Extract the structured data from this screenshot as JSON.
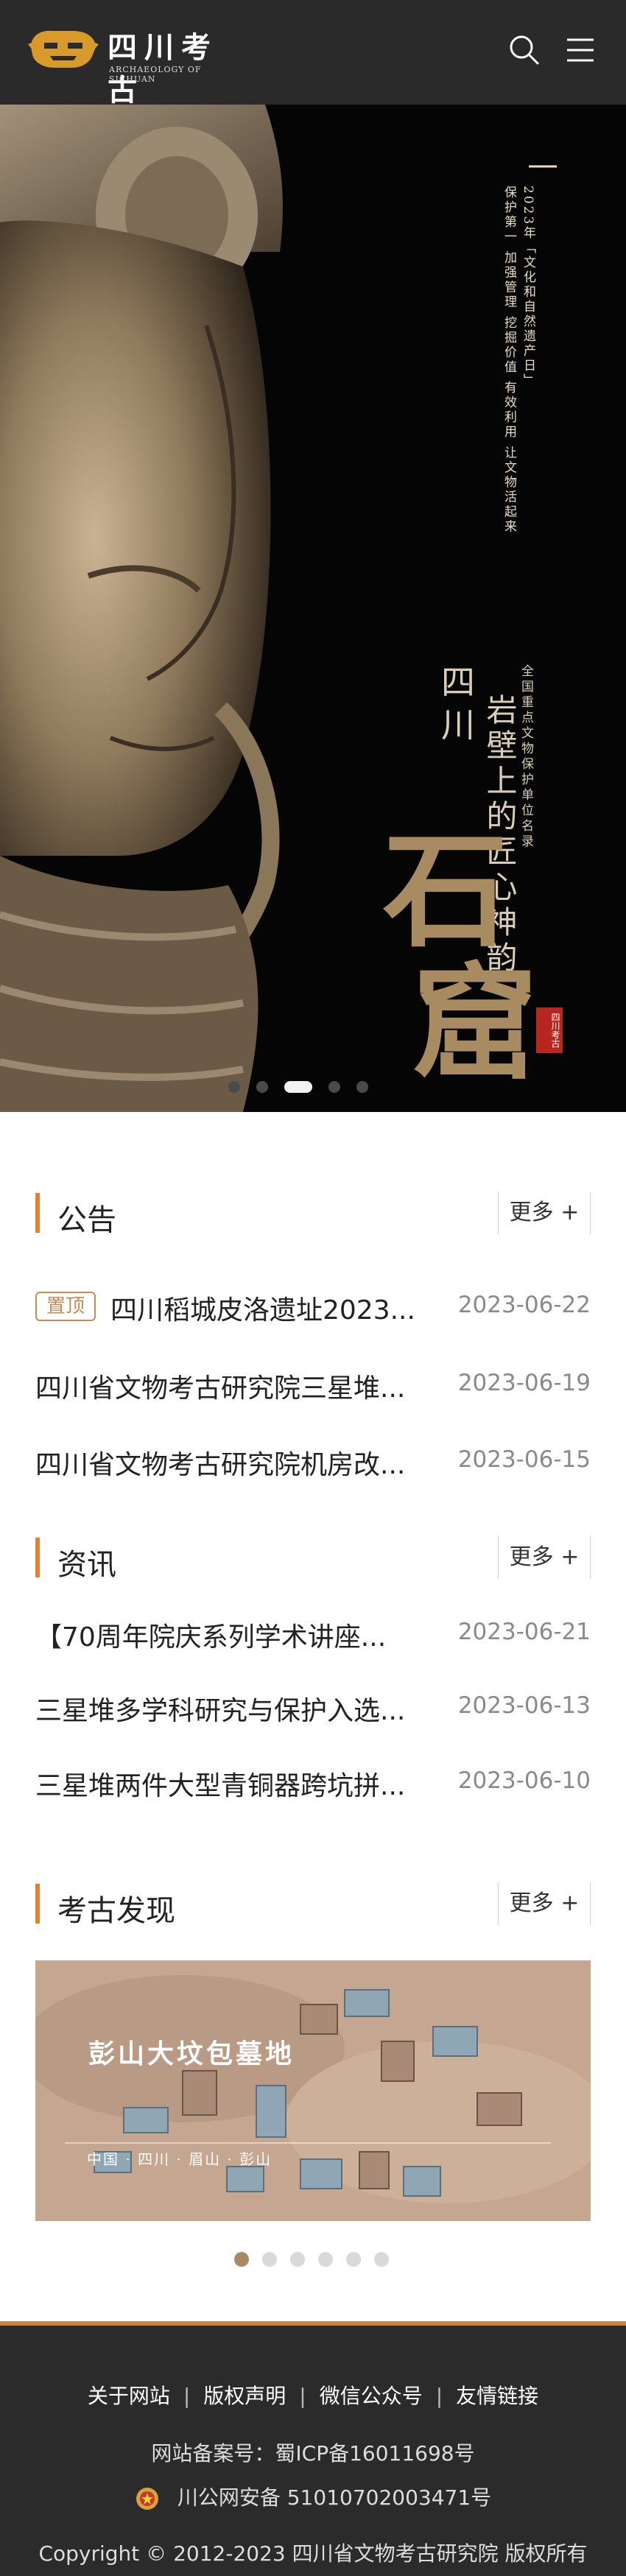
{
  "header": {
    "logo_cn": "四川考古",
    "logo_en": "ARCHAEOLOGY OF SICHUAN",
    "search_icon": "search-icon",
    "menu_icon": "hamburger-icon"
  },
  "banner": {
    "slogan_line1": "2023年「文化和自然遗产日」",
    "slogan_line2": "保护第一 加强管理 挖掘价值 有效利用 让文物活起来",
    "region": "四川",
    "subtitle": "全国重点文物保护单位名录",
    "main_title": "岩壁上的匠心神韵",
    "char1": "石",
    "char2": "窟",
    "seal_text": "四川考古",
    "slide_count": 5,
    "active_slide": 2
  },
  "announcements": {
    "title": "公告",
    "more": "更多 +",
    "pin_label": "置顶",
    "items": [
      {
        "title": "四川稻城皮洛遗址2023...",
        "date": "2023-06-22",
        "pinned": true
      },
      {
        "title": "四川省文物考古研究院三星堆...",
        "date": "2023-06-19",
        "pinned": false
      },
      {
        "title": "四川省文物考古研究院机房改...",
        "date": "2023-06-15",
        "pinned": false
      }
    ]
  },
  "news": {
    "title": "资讯",
    "more": "更多 +",
    "items": [
      {
        "title": "【70周年院庆系列学术讲座...",
        "date": "2023-06-21"
      },
      {
        "title": "三星堆多学科研究与保护入选...",
        "date": "2023-06-13"
      },
      {
        "title": "三星堆两件大型青铜器跨坑拼...",
        "date": "2023-06-10"
      }
    ]
  },
  "discovery": {
    "title": "考古发现",
    "more": "更多 +",
    "card_title": "彭山大坟包墓地",
    "card_subtitle": "中国 · 四川 · 眉山 · 彭山",
    "dot_count": 6,
    "active_dot": 0
  },
  "footer": {
    "links": [
      "关于网站",
      "版权声明",
      "微信公众号",
      "友情链接"
    ],
    "separator": "|",
    "icp": "网站备案号：蜀ICP备16011698号",
    "police": "川公网安备 51010702003471号",
    "copyright": "Copyright © 2012-2023 四川省文物考古研究院 版权所有"
  },
  "colors": {
    "accent": "#e0822f",
    "header_bg": "#2a2a2a",
    "footer_bg": "#2b2b2b",
    "pin": "#c98a55",
    "date": "#8a8a8a",
    "seal": "#b8271f"
  }
}
